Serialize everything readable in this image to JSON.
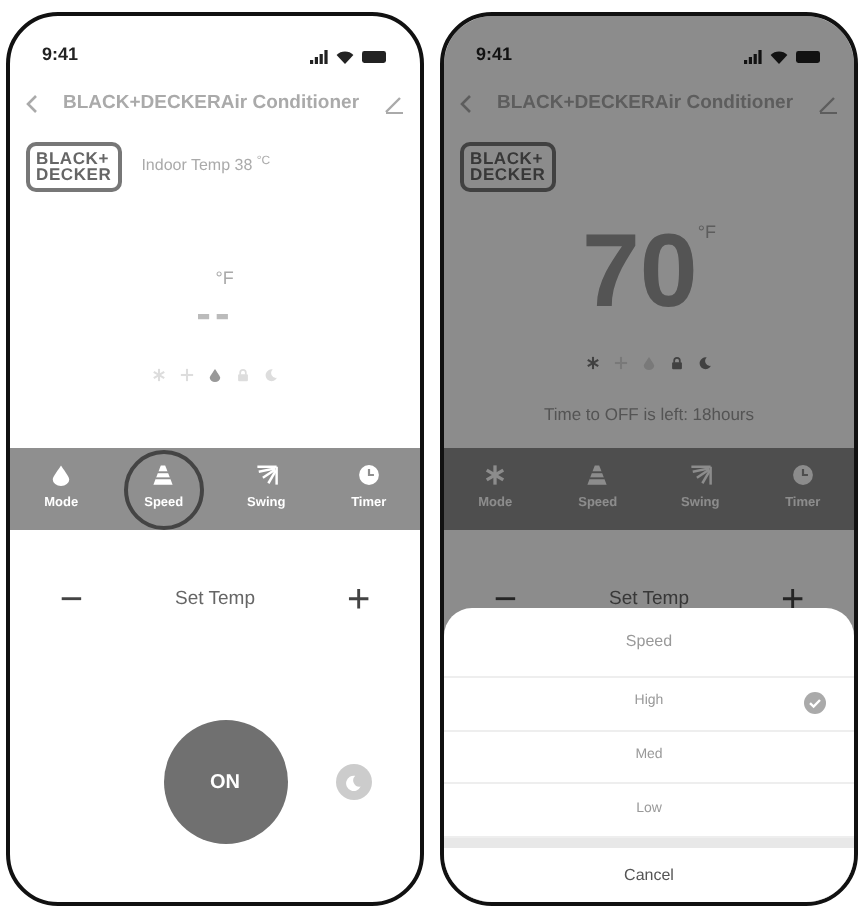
{
  "screens": [
    {
      "status_time": "9:41",
      "title": "BLACK+DECKERAir Conditioner",
      "logo": "BLACK+ DECKER",
      "indoor_temp": "Indoor Temp 38",
      "indoor_unit": "°C",
      "temperature": "--",
      "temp_unit": "°F",
      "mode_indicators": [
        {
          "kind": "snowflake",
          "active": false
        },
        {
          "kind": "fan",
          "active": false
        },
        {
          "kind": "drop",
          "active": true
        },
        {
          "kind": "lock",
          "active": false
        },
        {
          "kind": "moon",
          "active": false
        }
      ],
      "tabs": [
        {
          "label": "Mode",
          "kind": "drop",
          "highlighted": false
        },
        {
          "label": "Speed",
          "kind": "cone",
          "highlighted": true
        },
        {
          "label": "Swing",
          "kind": "swing",
          "highlighted": false
        },
        {
          "label": "Timer",
          "kind": "clock",
          "highlighted": false
        }
      ],
      "set_temp": {
        "minus": "−",
        "label": "Set Temp",
        "plus": "+"
      },
      "power_button": "ON",
      "dimmed": false
    },
    {
      "status_time": "9:41",
      "title": "BLACK+DECKERAir Conditioner",
      "logo": "BLACK+ DECKER",
      "temperature": "70",
      "temp_unit": "°F",
      "mode_indicators": [
        {
          "kind": "snowflake",
          "active": true
        },
        {
          "kind": "fan",
          "active": false
        },
        {
          "kind": "drop",
          "active": false
        },
        {
          "kind": "lock",
          "active": true
        },
        {
          "kind": "moon",
          "active": true
        }
      ],
      "timer_text": "Time to OFF is left: 18hours",
      "tabs": [
        {
          "label": "Mode",
          "kind": "snowflake",
          "highlighted": false
        },
        {
          "label": "Speed",
          "kind": "cone",
          "highlighted": false
        },
        {
          "label": "Swing",
          "kind": "swing",
          "highlighted": false
        },
        {
          "label": "Timer",
          "kind": "clock",
          "highlighted": false
        }
      ],
      "set_temp": {
        "minus": "−",
        "label": "Set Temp",
        "plus": "+"
      },
      "dimmed": true,
      "sheet": {
        "title": "Speed",
        "options": [
          {
            "label": "High",
            "selected": true
          },
          {
            "label": "Med",
            "selected": false
          },
          {
            "label": "Low",
            "selected": false
          }
        ],
        "cancel": "Cancel"
      }
    }
  ]
}
